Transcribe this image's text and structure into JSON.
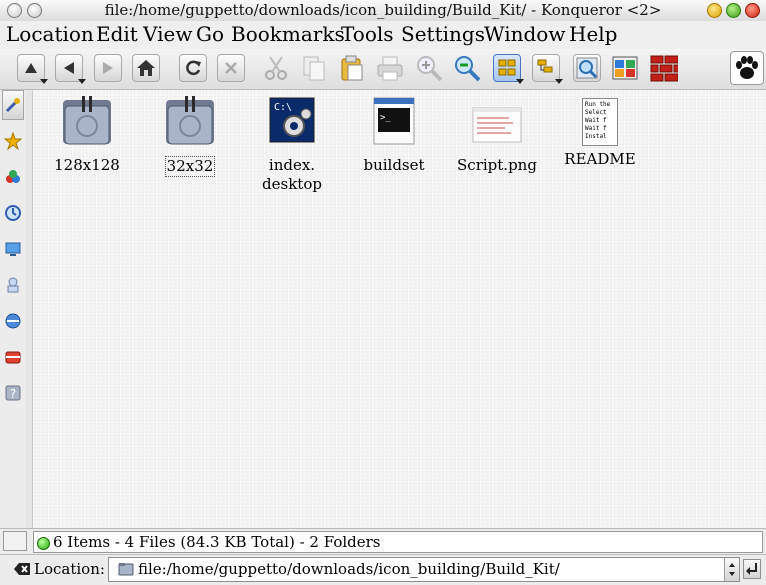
{
  "window": {
    "title": "file:/home/guppetto/downloads/icon_building/Build_Kit/ - Konqueror <2>"
  },
  "menu": [
    {
      "label": "Location"
    },
    {
      "label": "Edit"
    },
    {
      "label": "View"
    },
    {
      "label": "Go"
    },
    {
      "label": "Bookmarks"
    },
    {
      "label": "Tools"
    },
    {
      "label": "Settings"
    },
    {
      "label": "Window"
    },
    {
      "label": "Help"
    }
  ],
  "toolbar": {
    "buttons": [
      "up-icon",
      "back-icon",
      "forward-icon",
      "home-icon",
      "reload-icon",
      "stop-icon",
      "cut-icon",
      "copy-icon",
      "paste-icon",
      "print-icon",
      "zoom-in-icon",
      "zoom-out-icon",
      "icon-view-icon",
      "tree-view-icon",
      "find-icon",
      "multi-view-icon",
      "konsole-icon",
      "throbber-icon"
    ]
  },
  "sidebar": {
    "buttons": [
      "configure-icon",
      "bookmarks-icon",
      "services-icon",
      "history-icon",
      "home-folder-icon",
      "network-icon",
      "devices-icon",
      "root-folder-icon",
      "help-icon"
    ]
  },
  "files": [
    {
      "name": "128x128",
      "icon": "folder-icon"
    },
    {
      "name": "32x32",
      "icon": "folder-icon"
    },
    {
      "name": "index.\ndesktop",
      "icon": "desktop-file-icon"
    },
    {
      "name": "buildset",
      "icon": "shell-script-icon"
    },
    {
      "name": "Script.png",
      "icon": "image-file-icon"
    },
    {
      "name": "README",
      "icon": "text-file-icon"
    }
  ],
  "readme_preview": "Run the\nSelect\nWait f\nWait f\nInstal",
  "status": {
    "text": "6 Items - 4 Files (84.3 KB Total) - 2 Folders"
  },
  "location": {
    "label": "Location:",
    "value": "file:/home/guppetto/downloads/icon_building/Build_Kit/"
  }
}
